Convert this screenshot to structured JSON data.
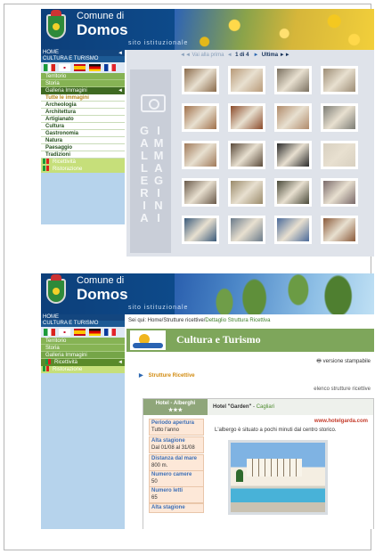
{
  "site": {
    "comune": "Comune di",
    "name": "Domos",
    "tagline": "sito istituzionale"
  },
  "menu": {
    "home": "HOME",
    "section": "CULTURA E TURISMO",
    "languages": [
      "it-flag-icon",
      "en-flag-icon",
      "es-flag-icon",
      "de-flag-icon",
      "fr-flag-icon"
    ],
    "items": [
      "Territorio",
      "Storia",
      "Galleria Immagini"
    ],
    "sub_items": [
      "Tutte le immagini",
      "Archeologia",
      "Architettura",
      "Artigianato",
      "Cultura",
      "Gastronomia",
      "Natura",
      "Paesaggio",
      "Tradizioni"
    ],
    "ricettivita": "Ricettività",
    "ristorazione": "Ristorazione"
  },
  "gallery": {
    "nav_first": "◄◄ Vai alla prima",
    "nav_prev": "◄",
    "page": "1 di 4",
    "nav_next": "►",
    "nav_last": "Ultima ►►",
    "vertical_label_1": "GALLERIA",
    "vertical_label_2": "IMMAGINI",
    "thumb_colors": [
      [
        "#8a6a4a",
        "#b89a78",
        "#7a7060",
        "#9c8c74"
      ],
      [
        "#a0704a",
        "#8b4a2a",
        "#b08a6a",
        "#7c7c74"
      ],
      [
        "#a07a5a",
        "#5a4a3a",
        "#2a2a2a",
        "#d8d0c0"
      ],
      [
        "#6a5a4a",
        "#9a8a6a",
        "#4a4a3a",
        "#7a6a6a"
      ],
      [
        "#3a5a7a",
        "#6a7a8a",
        "#4a6a9a",
        "#8a5a3a"
      ]
    ]
  },
  "detail": {
    "crumb_prefix": "Sei qui: Home/Strutture ricettive/",
    "crumb_current": "Dettaglio Struttura Ricettiva",
    "banner_title": "Cultura e Turismo",
    "print_label": "versione stampabile",
    "strutture_label": "Strutture Ricettive",
    "elenco_label": "elenco strutture ricettive",
    "category": "Hotel - Alberghi",
    "stars": "★★★",
    "hotel_name": "Hotel \"Garden\"",
    "hotel_city": "Cagliari",
    "url": "www.hotelgarda.com",
    "description": "L'albergo è situato a pochi minuti dal centro storico.",
    "info": [
      {
        "k": "Periodo apertura",
        "v": "Tutto l'anno"
      },
      {
        "k": "Alta stagione",
        "v": "Dal 01/08 al 31/08"
      },
      {
        "k": "Distanza dal mare",
        "v": "800 m."
      },
      {
        "k": "Numero camere",
        "v": "50"
      },
      {
        "k": "Numero letti",
        "v": "65"
      },
      {
        "k": "Alta stagione",
        "v": ""
      }
    ]
  }
}
